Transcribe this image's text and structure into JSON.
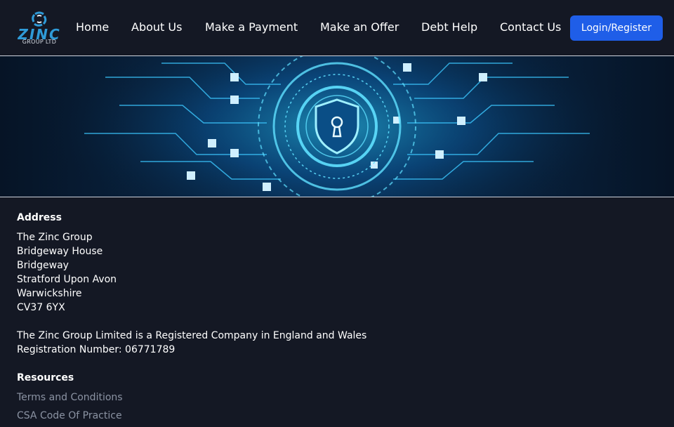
{
  "brand": {
    "logo_text": "ZINC",
    "logo_sub": "GROUP LTD",
    "accent": "#2f9bd8"
  },
  "nav": {
    "items": [
      {
        "label": "Home"
      },
      {
        "label": "About Us"
      },
      {
        "label": "Make a Payment"
      },
      {
        "label": "Make an Offer"
      },
      {
        "label": "Debt Help"
      },
      {
        "label": "Contact Us"
      }
    ],
    "login_label": "Login/Register",
    "login_color": "#1f5ee8"
  },
  "hero": {
    "image": "cyber-security-shield-keyhole-circuit-banner"
  },
  "address": {
    "heading": "Address",
    "lines": [
      "The Zinc Group",
      "Bridgeway House",
      "Bridgeway",
      "Stratford Upon Avon",
      "Warwickshire",
      "CV37 6YX"
    ],
    "company_note": "The Zinc Group Limited is a Registered Company in England and Wales",
    "registration": "Registration Number: 06771789"
  },
  "resources": {
    "heading": "Resources",
    "links": [
      {
        "label": "Terms and Conditions"
      },
      {
        "label": "CSA Code Of Practice"
      }
    ]
  }
}
